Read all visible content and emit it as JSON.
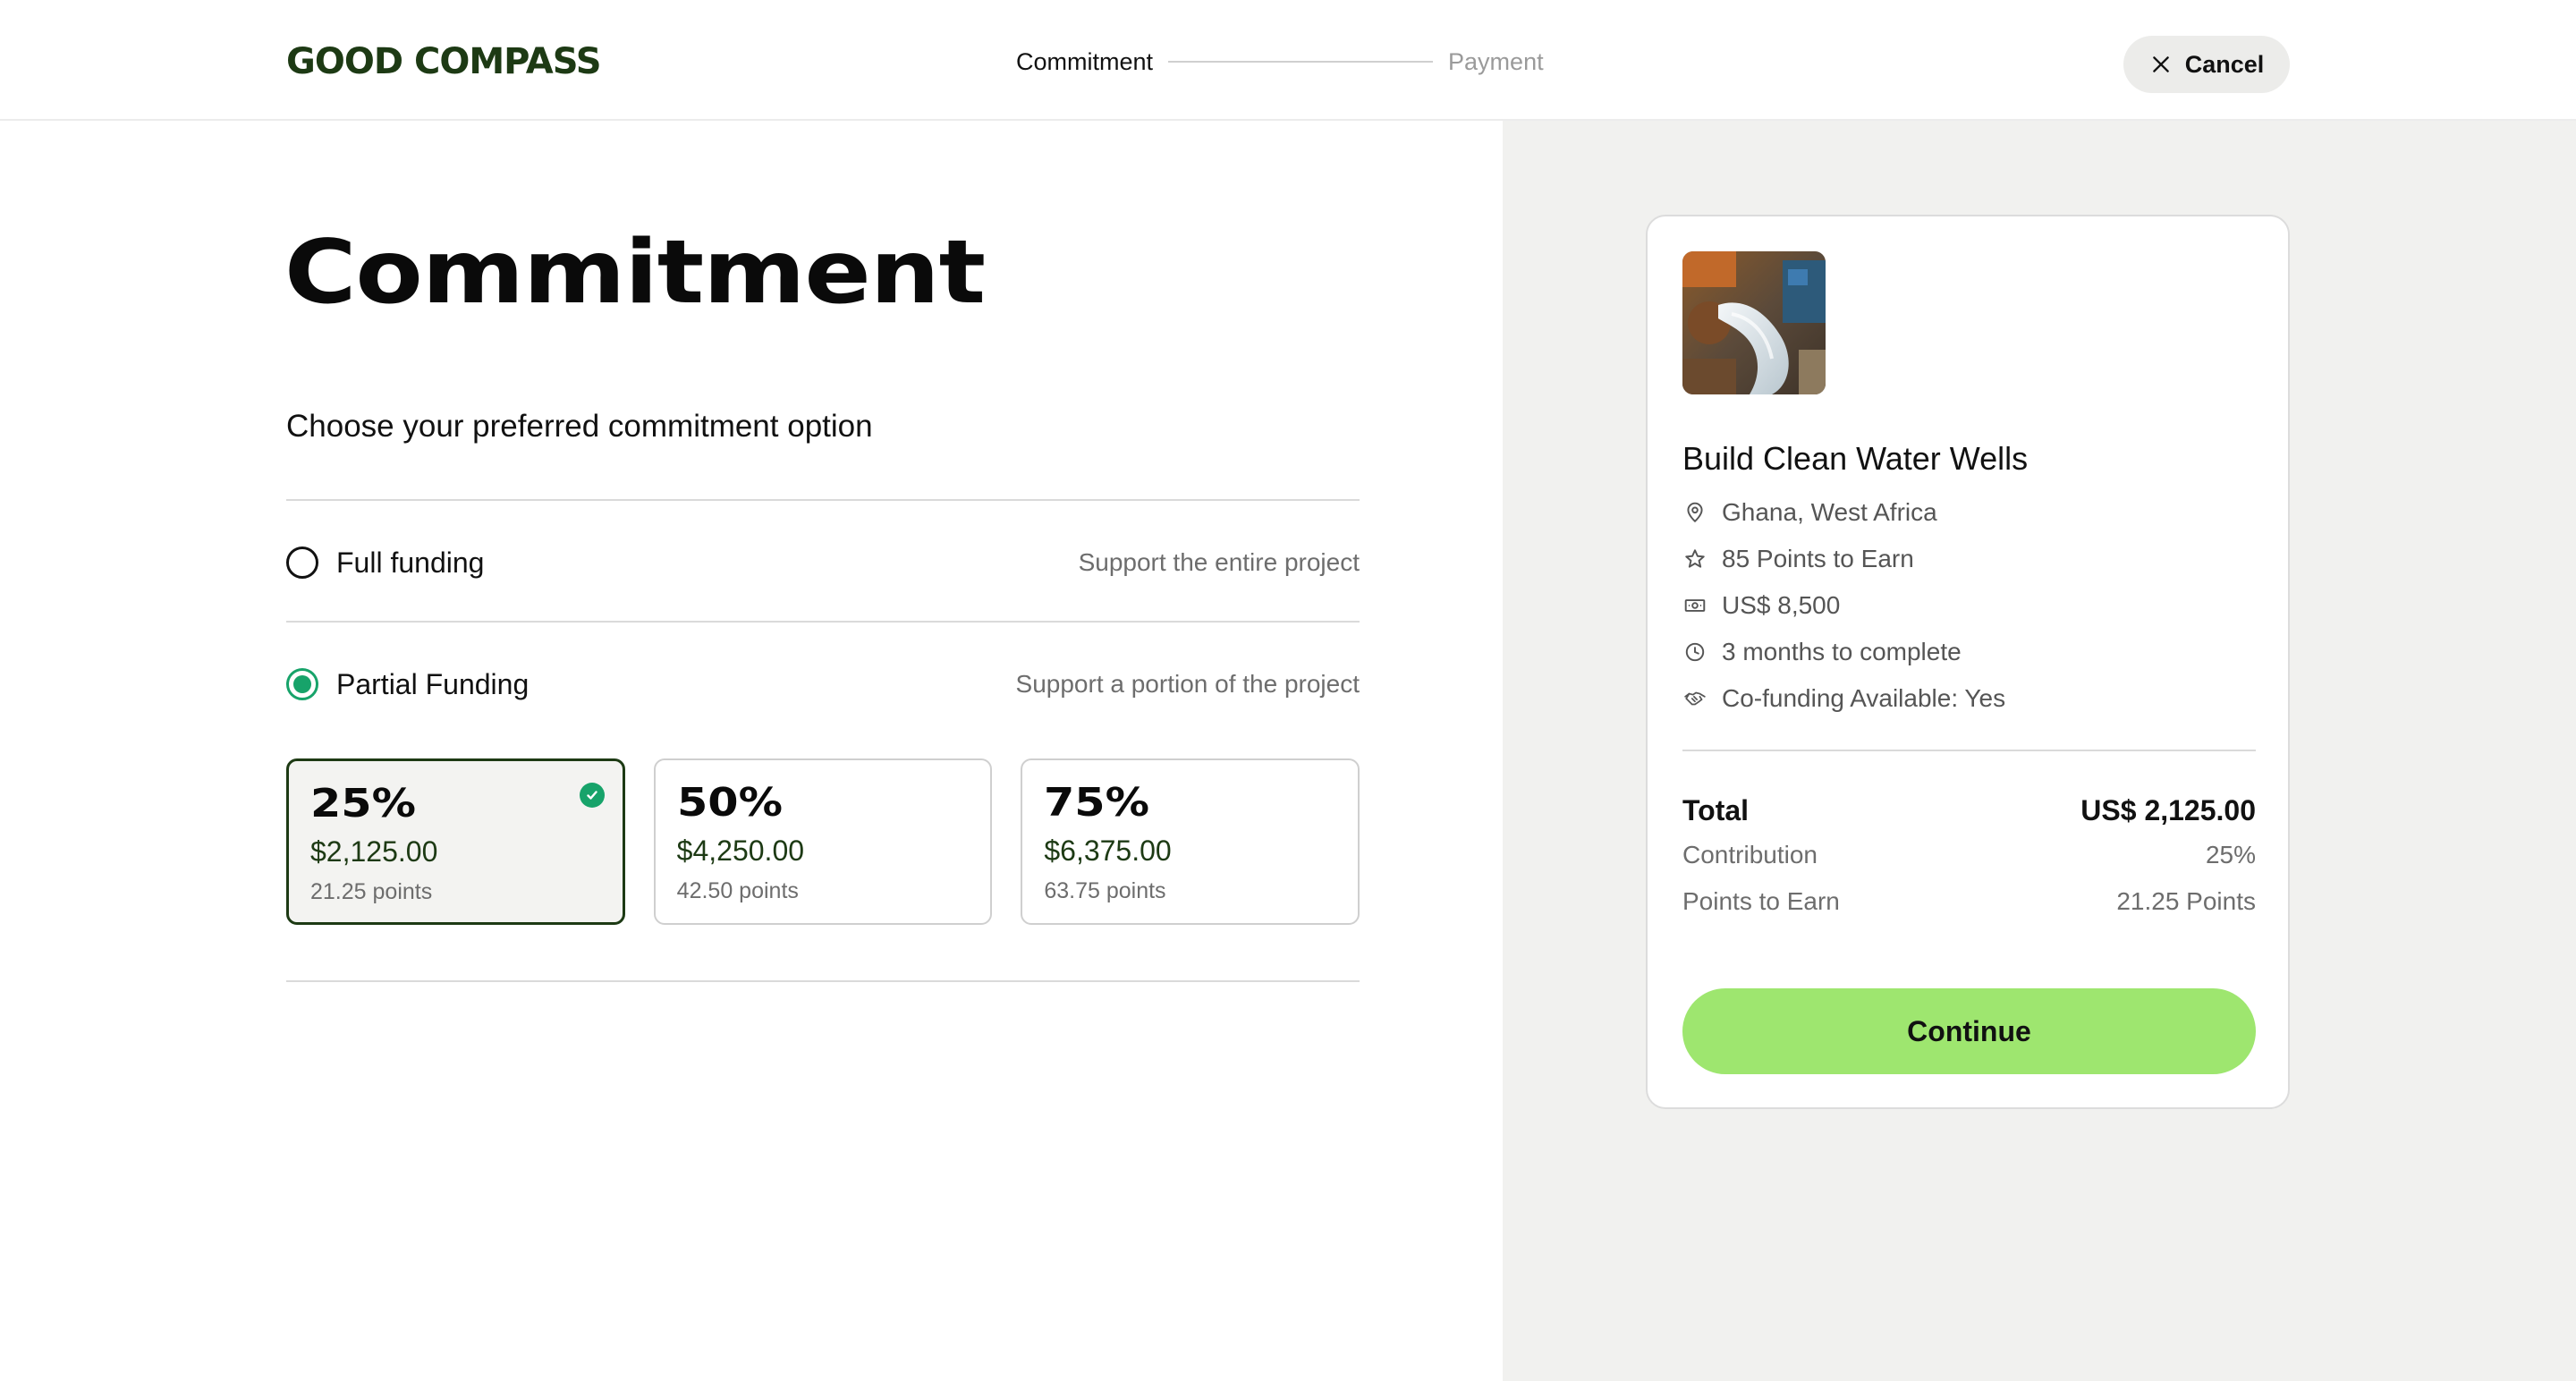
{
  "header": {
    "logo": "GOOD COMPASS",
    "steps": [
      {
        "label": "Commitment",
        "state": "active"
      },
      {
        "label": "Payment",
        "state": "inactive"
      }
    ],
    "cancel_label": "Cancel"
  },
  "main": {
    "title": "Commitment",
    "subtitle": "Choose your preferred commitment option",
    "options": [
      {
        "label": "Full funding",
        "description": "Support the entire project",
        "selected": false
      },
      {
        "label": "Partial Funding",
        "description": "Support a portion of the project",
        "selected": true
      }
    ],
    "partial_options": [
      {
        "percent": "25%",
        "amount": "$2,125.00",
        "points": "21.25 points",
        "selected": true
      },
      {
        "percent": "50%",
        "amount": "$4,250.00",
        "points": "42.50 points",
        "selected": false
      },
      {
        "percent": "75%",
        "amount": "$6,375.00",
        "points": "63.75 points",
        "selected": false
      }
    ]
  },
  "summary": {
    "project_title": "Build Clean Water Wells",
    "meta": [
      {
        "icon": "location-pin-icon",
        "text": "Ghana, West Africa"
      },
      {
        "icon": "star-icon",
        "text": "85 Points to Earn"
      },
      {
        "icon": "cash-icon",
        "text": "US$ 8,500"
      },
      {
        "icon": "clock-icon",
        "text": "3 months to complete"
      },
      {
        "icon": "handshake-icon",
        "text": "Co-funding Available: Yes"
      }
    ],
    "total_label": "Total",
    "total_value": "US$ 2,125.00",
    "contribution_label": "Contribution",
    "contribution_value": "25%",
    "points_label": "Points to Earn",
    "points_value": "21.25 Points",
    "continue_label": "Continue"
  },
  "colors": {
    "accent_green": "#17a36a",
    "continue_button": "#9ee66f",
    "logo_dark_green": "#1d3a14",
    "panel_grey": "#f1f1ef"
  }
}
